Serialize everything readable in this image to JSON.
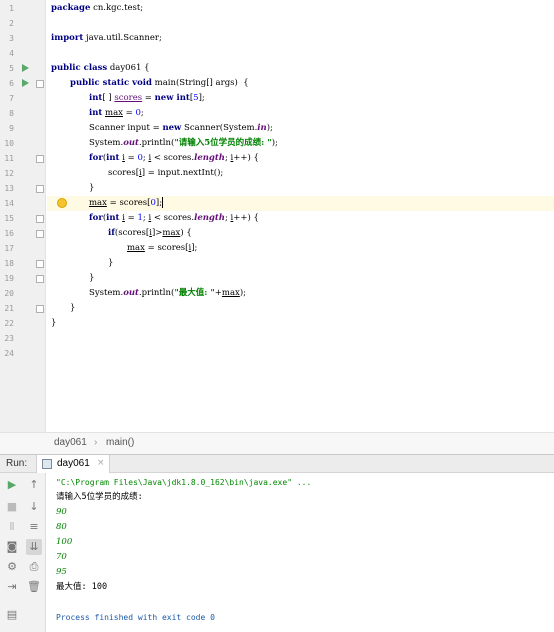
{
  "editor": {
    "line_numbers": [
      "1",
      "2",
      "3",
      "4",
      "5",
      "6",
      "7",
      "8",
      "9",
      "10",
      "11",
      "12",
      "13",
      "14",
      "15",
      "16",
      "17",
      "18",
      "19",
      "20",
      "21",
      "22",
      "23",
      "24"
    ],
    "code": {
      "l1_kw": "package",
      "l1_rest": " cn.kgc.test;",
      "l3_kw": "import",
      "l3_rest": " java.util.Scanner;",
      "l5_kw": "public class",
      "l5_rest": " day061 {",
      "l6_kw": "public static void",
      "l6_rest": " main(String[] args)  {",
      "l7_kw": "int",
      "l7_a": "[ ] ",
      "l7_var": "scores",
      "l7_b": " = ",
      "l7_kw2": "new int",
      "l7_c": "[",
      "l7_num": "5",
      "l7_d": "];",
      "l8_kw": "int",
      "l8_a": " ",
      "l8_var": "max",
      "l8_b": " = ",
      "l8_num": "0",
      "l8_c": ";",
      "l9_a": "Scanner input = ",
      "l9_kw": "new",
      "l9_b": " Scanner(System.",
      "l9_fld": "in",
      "l9_c": ");",
      "l10_a": "System.",
      "l10_fld": "out",
      "l10_b": ".println(",
      "l10_str": "\"请输入5位学员的成绩: \"",
      "l10_c": ");",
      "l11_kw": "for",
      "l11_a": "(",
      "l11_kw2": "int",
      "l11_b": " ",
      "l11_i1": "i",
      "l11_c": " = ",
      "l11_num": "0",
      "l11_d": "; ",
      "l11_i2": "i",
      "l11_e": " < scores.",
      "l11_fld": "length",
      "l11_f": "; ",
      "l11_i3": "i",
      "l11_g": "++) {",
      "l12_a": "scores[",
      "l12_i": "i",
      "l12_b": "] = input.nextInt();",
      "l13": "}",
      "l14_var": "max",
      "l14_a": " = scores[",
      "l14_num": "0",
      "l14_b": "];",
      "l15_kw": "for",
      "l15_a": "(",
      "l15_kw2": "int",
      "l15_b": " ",
      "l15_i1": "i",
      "l15_c": " = ",
      "l15_num": "1",
      "l15_d": "; ",
      "l15_i2": "i",
      "l15_e": " < scores.",
      "l15_fld": "length",
      "l15_f": "; ",
      "l15_i3": "i",
      "l15_g": "++) {",
      "l16_kw": "if",
      "l16_a": "(scores[",
      "l16_i": "i",
      "l16_b": "]>",
      "l16_var": "max",
      "l16_c": ") {",
      "l17_var": "max",
      "l17_a": " = scores[",
      "l17_i": "i",
      "l17_b": "];",
      "l18": "}",
      "l19": "}",
      "l20_a": "System.",
      "l20_fld": "out",
      "l20_b": ".println(",
      "l20_str": "\"最大值: \"",
      "l20_c": "+",
      "l20_var": "max",
      "l20_d": ");",
      "l21": "}",
      "l22": "}"
    }
  },
  "breadcrumb": {
    "class": "day061",
    "separator": "›",
    "method": "main()"
  },
  "run": {
    "label": "Run:",
    "tab_label": "day061",
    "tab_close": "×",
    "console": {
      "cmd": "\"C:\\Program Files\\Java\\jdk1.8.0_162\\bin\\java.exe\" ...",
      "prompt": "请输入5位学员的成绩:",
      "inputs": [
        "90",
        "80",
        "100",
        "70",
        "95"
      ],
      "result": "最大值: 100",
      "exit": "Process finished with exit code 0"
    }
  },
  "colors": {
    "keyword": "#000080",
    "string": "#008000",
    "field": "#660e7a",
    "number": "#0000ff",
    "run_green": "#59a869",
    "current_line": "#fffae3"
  }
}
